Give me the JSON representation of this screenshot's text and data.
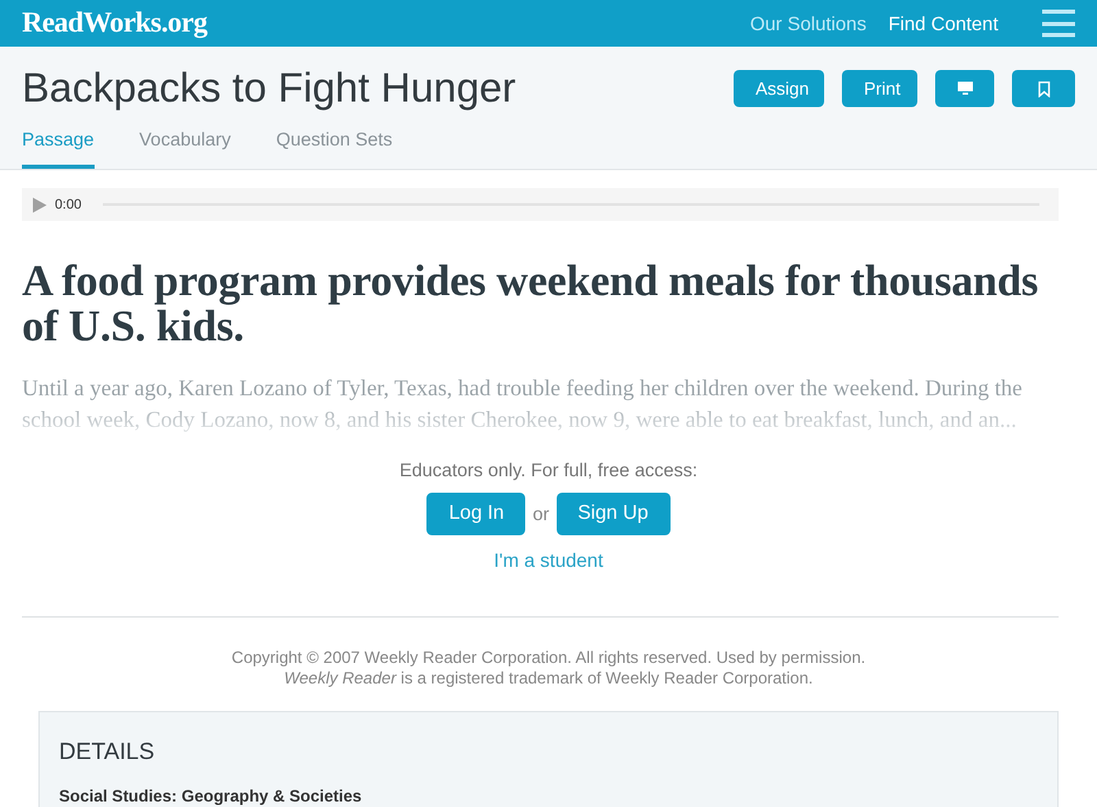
{
  "header": {
    "logo": "ReadWorks.org",
    "nav": [
      "Our Solutions",
      "Find Content"
    ]
  },
  "title": "Backpacks to Fight Hunger",
  "actions": [
    {
      "kind": "text",
      "label": "Assign"
    },
    {
      "kind": "text",
      "label": "Print"
    },
    {
      "kind": "screen"
    },
    {
      "kind": "bookmark"
    }
  ],
  "tabs": [
    {
      "label": "Passage",
      "selected": true
    },
    {
      "label": "Vocabulary",
      "selected": false
    },
    {
      "label": "Question Sets",
      "selected": false
    }
  ],
  "audio": {
    "time": "0:00"
  },
  "headline": "A food program provides weekend meals for thousands of U.S. kids.",
  "excerpt": "Until a year ago, Karen Lozano of Tyler, Texas, had trouble feeding her children over the weekend. During the school week, Cody Lozano, now 8, and his sister Cherokee, now 9, were able to eat breakfast, lunch, and an...",
  "access": {
    "prompt": "Educators only. For full, free access:",
    "login": "Log In",
    "separator": "or",
    "signup": "Sign Up",
    "student_link": "I'm a student"
  },
  "copyright": [
    "Copyright © 2007 Weekly Reader Corporation. All rights reserved. Used by permission.",
    "*Weekly Reader* is a registered trademark of Weekly Reader Corporation."
  ],
  "details": {
    "heading": "DETAILS",
    "subject": "Social Studies: Geography & Societies"
  }
}
